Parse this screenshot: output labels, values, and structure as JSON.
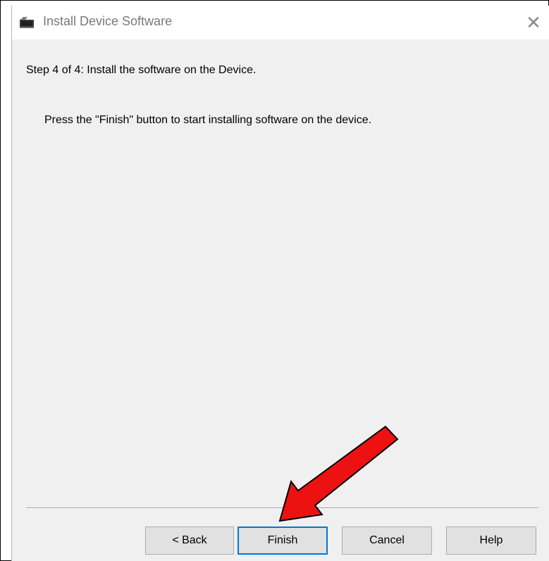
{
  "window": {
    "title": "Install Device Software",
    "close_glyph": "✕"
  },
  "content": {
    "step": "Step 4 of 4:  Install the software on the Device.",
    "instruction": "Press the \"Finish\" button to start installing software on the device."
  },
  "buttons": {
    "back": "< Back",
    "finish": "Finish",
    "cancel": "Cancel",
    "help": "Help"
  },
  "icons": {
    "title": "device-software-icon",
    "annotation": "red-pointer-arrow"
  },
  "colors": {
    "arrow_fill": "#ee1111",
    "focus_border": "#0078d7"
  }
}
